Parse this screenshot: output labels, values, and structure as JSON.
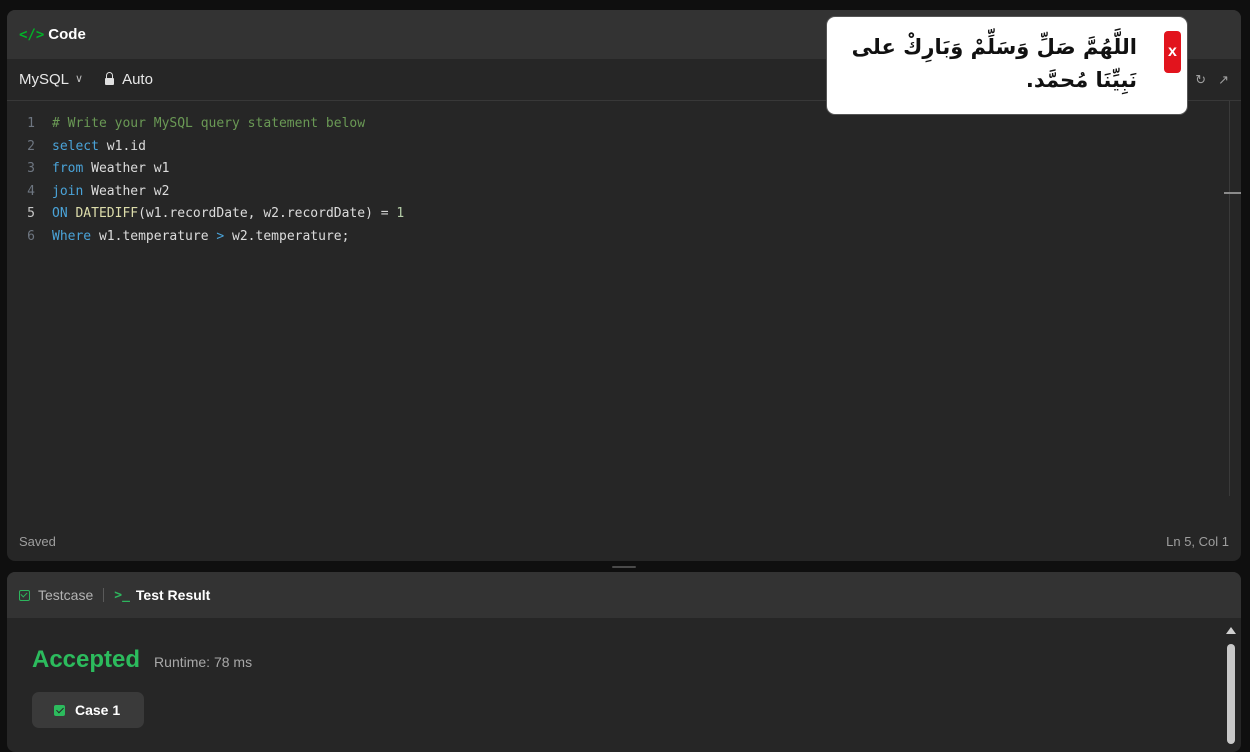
{
  "code_panel": {
    "title": "Code",
    "icon": "code-brackets-icon",
    "language": "MySQL",
    "mode": "Auto",
    "status_left": "Saved",
    "status_right": "Ln 5, Col 1",
    "lines": [
      {
        "no": "1",
        "tokens": [
          {
            "t": "# Write your MySQL query statement below",
            "c": "comment"
          }
        ]
      },
      {
        "no": "2",
        "tokens": [
          {
            "t": "select",
            "c": "kw"
          },
          {
            "t": " w1.id",
            "c": "id"
          }
        ]
      },
      {
        "no": "3",
        "tokens": [
          {
            "t": "from",
            "c": "kw"
          },
          {
            "t": " Weather w1",
            "c": "id"
          }
        ]
      },
      {
        "no": "4",
        "tokens": [
          {
            "t": "join",
            "c": "kw"
          },
          {
            "t": " Weather w2",
            "c": "id"
          }
        ]
      },
      {
        "no": "5",
        "active": true,
        "tokens": [
          {
            "t": "ON",
            "c": "kw"
          },
          {
            "t": " DATEDIFF",
            "c": "fn"
          },
          {
            "t": "(w1.recordDate, w2.recordDate)",
            "c": "id"
          },
          {
            "t": " = ",
            "c": "op"
          },
          {
            "t": "1",
            "c": "num"
          }
        ]
      },
      {
        "no": "6",
        "tokens": [
          {
            "t": "Where",
            "c": "kw"
          },
          {
            "t": " w1.temperature ",
            "c": "id"
          },
          {
            "t": ">",
            "c": "kw"
          },
          {
            "t": " w2.temperature;",
            "c": "id"
          }
        ]
      }
    ]
  },
  "result_panel": {
    "tab_testcase": "Testcase",
    "tab_result": "Test Result",
    "status": "Accepted",
    "runtime": "Runtime: 78 ms",
    "case_label": "Case 1"
  },
  "popup": {
    "text": "اللَّهُمَّ صَلِّ وَسَلِّمْ وَبَارِكْ على نَبِيِّنَا مُحمَّد.",
    "close_label": "x"
  },
  "colors": {
    "accepted": "#2cbb5d",
    "accent_green": "#02b128",
    "close_red": "#e2141d"
  }
}
